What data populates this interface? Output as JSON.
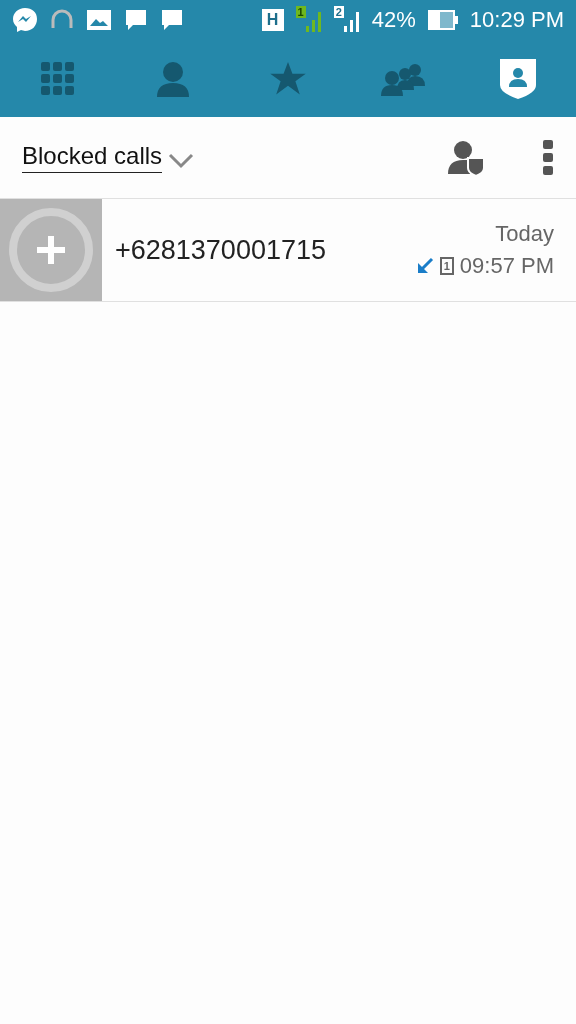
{
  "status_bar": {
    "network": "H",
    "sim_1": "1",
    "sim_2": "2",
    "battery": "42%",
    "time": "10:29 PM"
  },
  "tabs": [
    {
      "kind": "dialpad",
      "selected": false
    },
    {
      "kind": "contacts",
      "selected": false
    },
    {
      "kind": "favorites",
      "selected": false
    },
    {
      "kind": "groups",
      "selected": false
    },
    {
      "kind": "blocked",
      "selected": true
    }
  ],
  "header": {
    "title": "Blocked calls"
  },
  "calls": [
    {
      "number": "+6281370001715",
      "date": "Today",
      "sim": "1",
      "time": "09:57 PM",
      "kind": "incoming"
    }
  ]
}
